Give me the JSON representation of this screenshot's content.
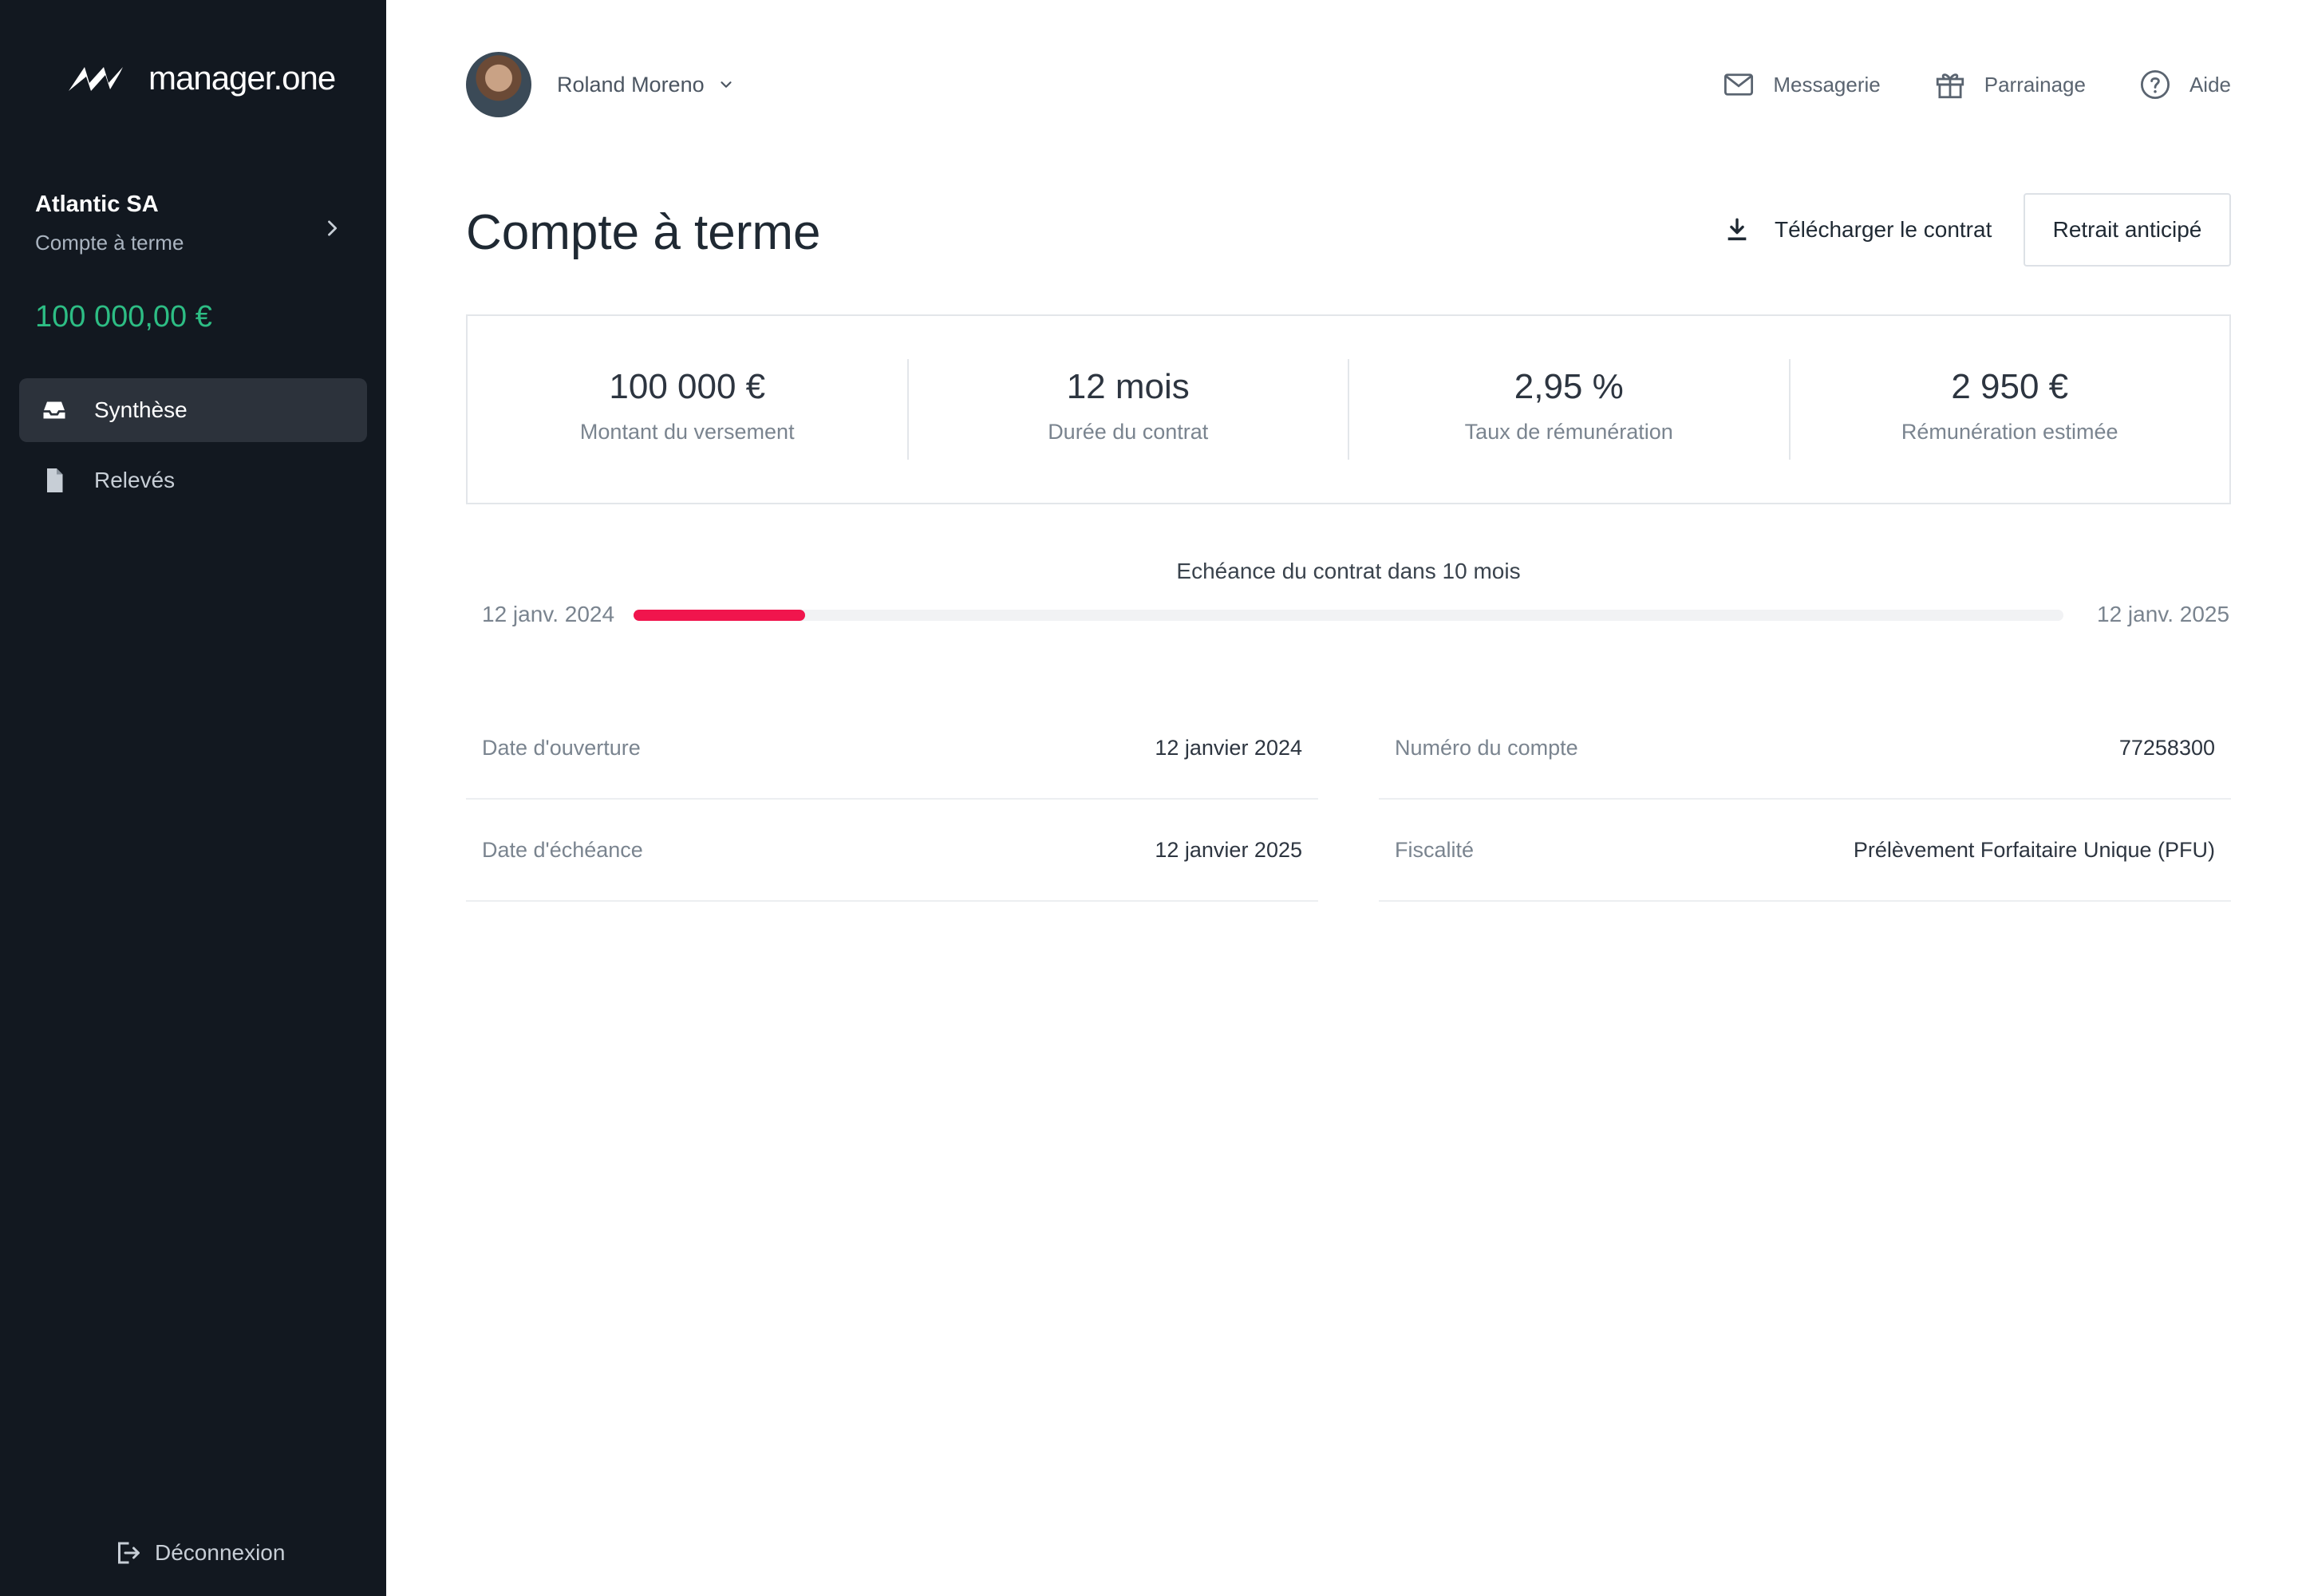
{
  "brand": {
    "name": "manager.one",
    "accent": "#2dbd84",
    "danger": "#f0154d",
    "sidebar_bg": "#121820"
  },
  "sidebar": {
    "account_name": "Atlantic SA",
    "account_type": "Compte à terme",
    "balance": "100 000,00 €",
    "items": [
      {
        "label": "Synthèse",
        "icon": "inbox-icon",
        "active": true
      },
      {
        "label": "Relevés",
        "icon": "document-icon",
        "active": false
      }
    ],
    "logout_label": "Déconnexion"
  },
  "topbar": {
    "user_name": "Roland Moreno",
    "links": [
      {
        "label": "Messagerie",
        "icon": "mail-icon"
      },
      {
        "label": "Parrainage",
        "icon": "gift-icon"
      },
      {
        "label": "Aide",
        "icon": "help-icon"
      }
    ]
  },
  "header": {
    "title": "Compte à terme",
    "download_label": "Télécharger le contrat",
    "withdraw_label": "Retrait anticipé"
  },
  "stats": [
    {
      "value": "100 000 €",
      "label": "Montant du versement"
    },
    {
      "value": "12 mois",
      "label": "Durée du contrat"
    },
    {
      "value": "2,95 %",
      "label": "Taux de rémunération"
    },
    {
      "value": "2 950 €",
      "label": "Rémunération estimée"
    }
  ],
  "progress": {
    "caption": "Echéance du contrat dans 10 mois",
    "start_label": "12 janv. 2024",
    "end_label": "12 janv. 2025",
    "fraction": 0.12
  },
  "details": {
    "left": [
      {
        "label": "Date d'ouverture",
        "value": "12 janvier 2024"
      },
      {
        "label": "Date d'échéance",
        "value": "12 janvier 2025"
      }
    ],
    "right": [
      {
        "label": "Numéro du compte",
        "value": "77258300"
      },
      {
        "label": "Fiscalité",
        "value": "Prélèvement Forfaitaire Unique (PFU)"
      }
    ]
  }
}
